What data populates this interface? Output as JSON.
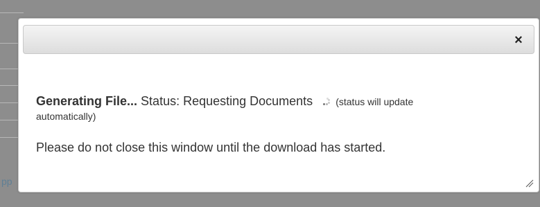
{
  "background": {
    "fragment_text": "pp"
  },
  "dialog": {
    "close_icon": "close-icon",
    "status": {
      "heading": "Generating File...",
      "label": "Status: Requesting Documents",
      "note_prefix": "(status will update",
      "note_suffix": "automatically)"
    },
    "message": "Please do not close this window until the download has started."
  },
  "colors": {
    "overlay": "#8d8d8d",
    "dialog_background": "#ffffff",
    "text": "#333333",
    "titlebar_top": "#f4f4f4",
    "titlebar_bottom": "#dddddd"
  }
}
